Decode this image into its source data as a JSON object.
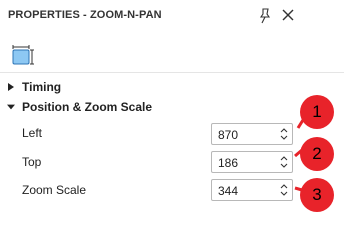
{
  "panel": {
    "title": "PROPERTIES - ZOOM-N-PAN",
    "pin_icon": "pin-icon",
    "close_icon": "close-icon",
    "tool_icon": "zoom-n-pan-icon"
  },
  "sections": {
    "timing": {
      "label": "Timing",
      "expanded": false
    },
    "position": {
      "label": "Position & Zoom Scale",
      "expanded": true
    }
  },
  "fields": {
    "left": {
      "label": "Left",
      "value": "870"
    },
    "top": {
      "label": "Top",
      "value": "186"
    },
    "zoom": {
      "label": "Zoom Scale",
      "value": "344"
    }
  },
  "callouts": [
    "1",
    "2",
    "3"
  ],
  "colors": {
    "callout": "#e8232a",
    "accent": "#4a9cd8"
  }
}
